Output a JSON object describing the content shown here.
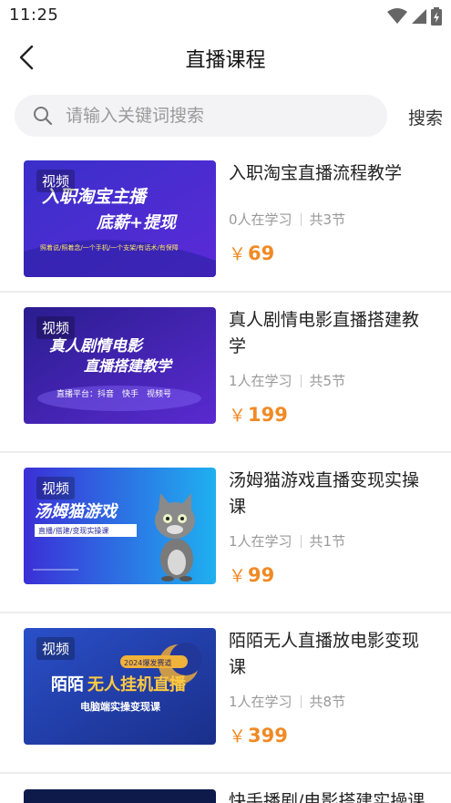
{
  "status_bar": {
    "time": "11:25"
  },
  "nav": {
    "title": "直播课程"
  },
  "search": {
    "placeholder": "请输入关键词搜索",
    "button_label": "搜索"
  },
  "courses": [
    {
      "tag": "视频",
      "title": "入职淘宝直播流程教学",
      "learners": "0人在学习",
      "lessons": "共3节",
      "price": "69",
      "currency": "￥",
      "thumb_line1": "入职淘宝主播",
      "thumb_line2": "底薪+提现",
      "thumb_line3": "照着说/照着念/一个手机/一个支架/有话术/有保障"
    },
    {
      "tag": "视频",
      "title": "真人剧情电影直播搭建教学",
      "learners": "1人在学习",
      "lessons": "共5节",
      "price": "199",
      "currency": "￥",
      "thumb_line1": "真人剧情电影",
      "thumb_line2": "直播搭建教学",
      "thumb_line3": "直播平台：抖音　快手　视频号"
    },
    {
      "tag": "视频",
      "title": "汤姆猫游戏直播变现实操课",
      "learners": "1人在学习",
      "lessons": "共1节",
      "price": "99",
      "currency": "￥",
      "thumb_line1": "汤姆猫游戏",
      "thumb_line2": "直播/搭建/变现实操课"
    },
    {
      "tag": "视频",
      "title": "陌陌无人直播放电影变现课",
      "learners": "1人在学习",
      "lessons": "共8节",
      "price": "399",
      "currency": "￥",
      "thumb_badge": "2024爆发赛道",
      "thumb_line1a": "陌陌",
      "thumb_line1b": "无人挂机直播",
      "thumb_line2": "电脑端实操变现课"
    }
  ],
  "partial_item": {
    "title": "快手播剧/电影搭建实操课"
  }
}
